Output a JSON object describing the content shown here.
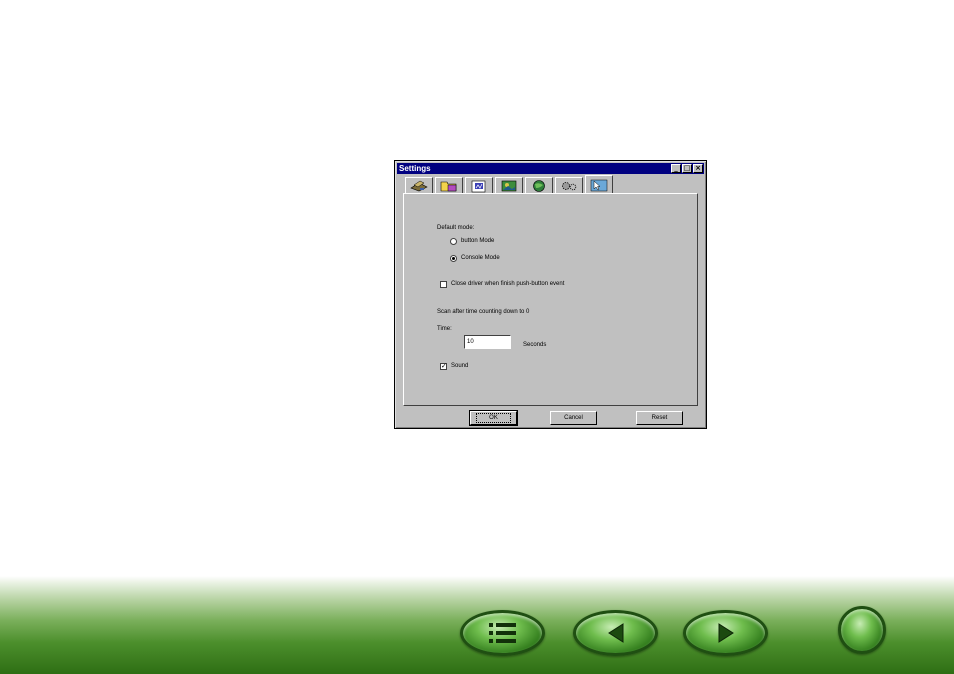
{
  "window": {
    "title": "Settings",
    "controls": {
      "minimize": "_",
      "maximize": "□",
      "close": "×"
    }
  },
  "tabs": [
    {
      "icon": "scanner-icon",
      "active": false
    },
    {
      "icon": "folder-image-icon",
      "active": false
    },
    {
      "icon": "document-icon",
      "active": false
    },
    {
      "icon": "picture-icon",
      "active": false
    },
    {
      "icon": "globe-icon",
      "active": false
    },
    {
      "icon": "settings-gears-icon",
      "active": false
    },
    {
      "icon": "cursor-arrow-icon",
      "active": true
    }
  ],
  "settings": {
    "default_mode_label": "Default mode:",
    "button_mode_label": "button Mode",
    "console_mode_label": "Console Mode",
    "selected_mode": "Console Mode",
    "close_driver_label": "Close driver when finish push-button event",
    "close_driver_checked": false,
    "countdown_label": "Scan after time counting down to 0",
    "time_label": "Time:",
    "time_value": "10",
    "seconds_label": "Seconds",
    "sound_label": "Sound",
    "sound_checked": true,
    "sound_check_mark": "✓"
  },
  "buttons": {
    "ok": "OK",
    "cancel": "Cancel",
    "reset": "Reset"
  },
  "footer_nav": [
    {
      "icon": "contents-list-icon"
    },
    {
      "icon": "previous-arrow-icon"
    },
    {
      "icon": "next-arrow-icon"
    },
    {
      "icon": "home-circle-icon"
    }
  ],
  "colors": {
    "titlebar": "#000080",
    "dialog_face": "#c0c0c0",
    "footer_green": "#2e6e14"
  }
}
